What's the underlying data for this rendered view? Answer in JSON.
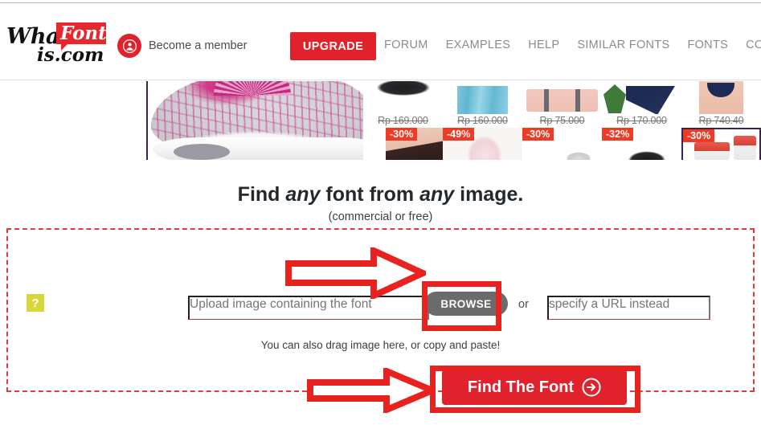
{
  "header": {
    "logo": {
      "part1": "What",
      "part2": "Font",
      "part3": "is.com"
    },
    "member_label": "Become a member",
    "member_icon": "user-avatar-icon",
    "upgrade_label": "UPGRADE",
    "nav": [
      {
        "label": "FORUM"
      },
      {
        "label": "EXAMPLES"
      },
      {
        "label": "HELP"
      },
      {
        "label": "SIMILAR FONTS"
      },
      {
        "label": "FONTS"
      },
      {
        "label": "CONTACT"
      }
    ]
  },
  "banner": {
    "products": [
      {
        "price": "Rp 169.000",
        "badge": "-30%"
      },
      {
        "price": "Rp 160.000",
        "badge": "-49%"
      },
      {
        "price": "Rp 75.000",
        "badge": "-30%"
      },
      {
        "price": "Rp 170.000",
        "badge": "-32%"
      },
      {
        "price": "Rp 740.40",
        "badge": "-30%"
      }
    ]
  },
  "main": {
    "headline_a": "Find ",
    "headline_em1": "any",
    "headline_b": " font from ",
    "headline_em2": "any",
    "headline_c": " image.",
    "subtitle": "(commercial or free)",
    "help_icon_label": "?",
    "upload_placeholder": "Upload image containing the font",
    "browse_label": "BROWSE",
    "or_label": "or",
    "url_placeholder": "specify a URL instead",
    "drag_hint": "You can also drag image here, or copy and paste!",
    "find_label": "Find The Font",
    "find_icon": "arrow-circle-right-icon"
  },
  "colors": {
    "brand_red": "#e0222c",
    "annotation_red": "#e8221f",
    "dropzone_border": "#e03b3b",
    "browse_gray": "#6b6b6b",
    "help_yellow": "#d8d73c",
    "badge_red": "#ef3b24"
  }
}
